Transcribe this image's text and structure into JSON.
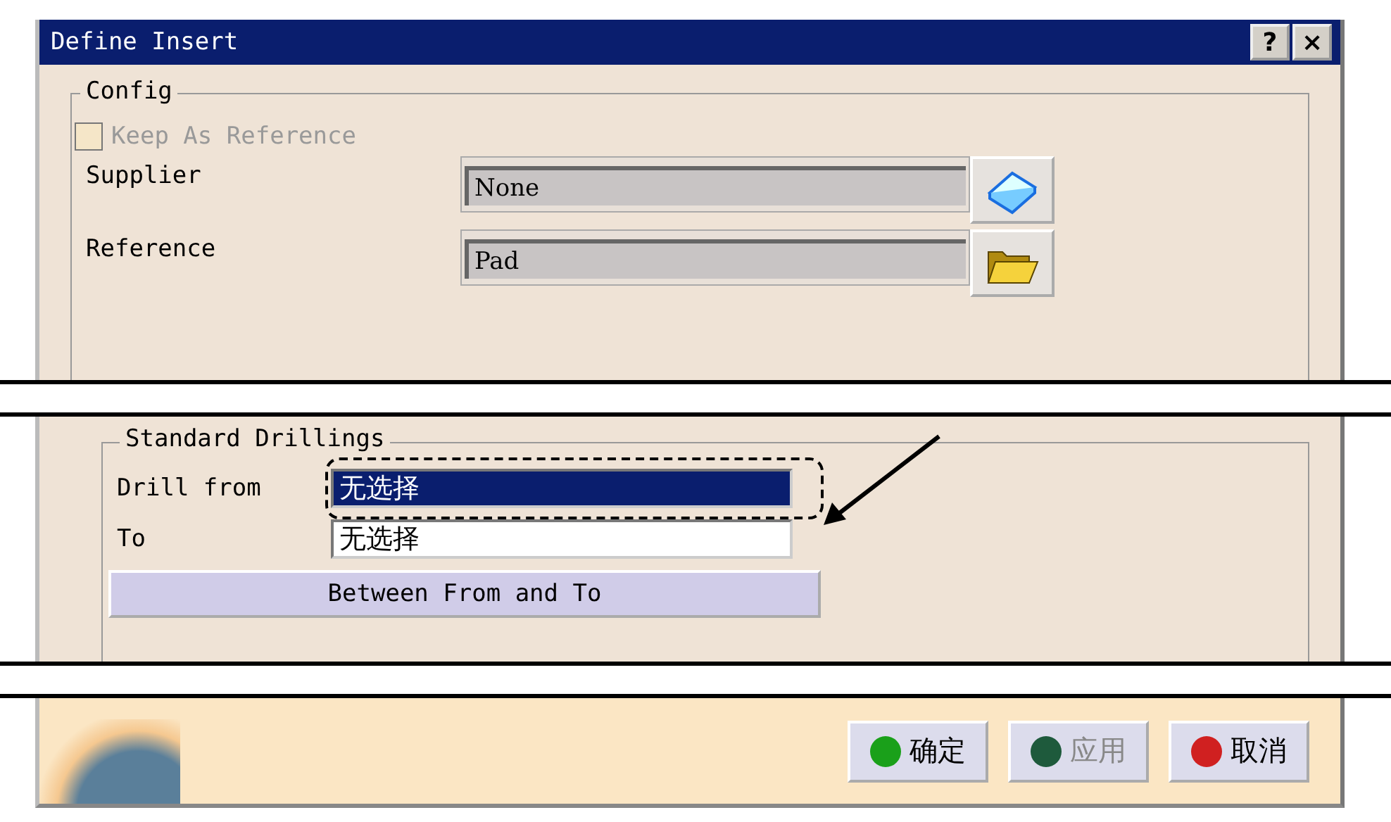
{
  "window": {
    "title": "Define Insert",
    "title_buttons": [
      "?",
      "×"
    ]
  },
  "config": {
    "legend": "Config",
    "keep_as_reference": {
      "label": "Keep As Reference",
      "checked": false,
      "disabled": true
    },
    "fields": [
      {
        "label": "Supplier",
        "value": "None",
        "kind": "book"
      },
      {
        "label": "Reference",
        "value": "Pad",
        "kind": "folder"
      }
    ]
  },
  "standard_drillings": {
    "legend": "Standard Drillings",
    "fields": [
      {
        "label": "Drill from",
        "value": "无选择",
        "selected": true
      },
      {
        "label": "To",
        "value": "无选择",
        "selected": false
      }
    ],
    "button": "Between From and To"
  },
  "buttons": [
    {
      "label": "确定",
      "color": "#1aa01a",
      "disabled": false
    },
    {
      "label": "应用",
      "color": "#1e5a3c",
      "disabled": true
    },
    {
      "label": "取消",
      "color": "#d02020",
      "disabled": false
    }
  ]
}
